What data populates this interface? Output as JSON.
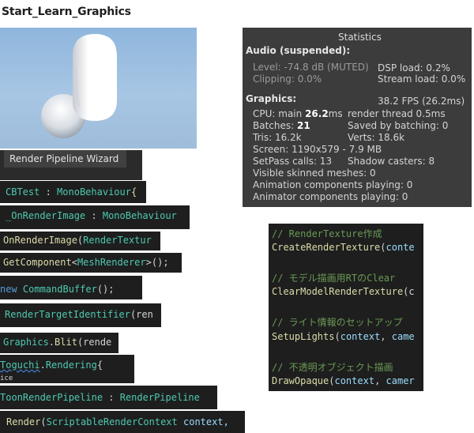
{
  "title": "Start_Learn_Graphics",
  "statistics": {
    "header": "Statistics",
    "audio_heading": "Audio (suspended):",
    "level": "Level: -74.8 dB (MUTED)",
    "clipping": "Clipping: 0.0%",
    "dsp_load": "DSP load: 0.2%",
    "stream_load": "Stream load: 0.0%",
    "graphics_heading": "Graphics:",
    "fps": "38.2 FPS (26.2ms)",
    "cpu_prefix": "CPU: main ",
    "cpu_value": "26.2",
    "cpu_suffix": "ms",
    "render_thread": "render thread 0.5ms",
    "batches_prefix": "Batches: ",
    "batches_value": "21",
    "saved_by_batching": "Saved by batching: 0",
    "tris": "Tris: 16.2k",
    "verts": "Verts: 18.6k",
    "screen": "Screen: 1190x579 - 7.9 MB",
    "setpass": "SetPass calls: 13",
    "shadow_casters": "Shadow casters: 8",
    "visible_skinned": "Visible skinned meshes: 0",
    "animation_components": "Animation components playing: 0",
    "animator_components": "Animator components playing: 0"
  },
  "wizard": {
    "label": "Render Pipeline Wizard"
  },
  "left_code": {
    "s1": {
      "a": "CBTest",
      "b": " : ",
      "c": "MonoBehaviour",
      "d": "{"
    },
    "s2": {
      "a": "_OnRenderImage",
      "b": " : ",
      "c": "MonoBehaviour"
    },
    "s3": {
      "a": "OnRenderImage",
      "b": "(",
      "c": "RenderTextur"
    },
    "s4": {
      "a": "GetComponent",
      "b": "<",
      "c": "MeshRenderer",
      "d": ">();"
    },
    "s5": {
      "a": "new ",
      "b": "CommandBuffer",
      "c": "();"
    },
    "s6": {
      "a": "RenderTargetIdentifier",
      "b": "(ren"
    },
    "s7": {
      "a": "Graphics",
      "b": ".",
      "c": "Blit",
      "d": "(rende"
    },
    "s8": {
      "a": "Toguchi",
      "b": ".",
      "c": "Rendering",
      "d": "{"
    },
    "s8_fragment": "ice",
    "s9": {
      "a": "ToonRenderPipeline",
      "b": " : ",
      "c": "RenderPipeline"
    },
    "s10": {
      "a": "Render",
      "b": "(",
      "c": "ScriptableRenderContext",
      "d": " context,"
    }
  },
  "right_code": {
    "c1": "// RenderTexture作成",
    "l1": {
      "a": "CreateRenderTexture",
      "b": "(",
      "c": "conte"
    },
    "c2": "// モデル描画用RTのClear",
    "l2": {
      "a": "ClearModelRenderTexture",
      "b": "(c"
    },
    "c3": "// ライト情報のセットアップ",
    "l3": {
      "a": "SetupLights",
      "b": "(",
      "c": "context",
      "d": ", ",
      "e": "came"
    },
    "c4": "// 不透明オブジェクト描画",
    "l4": {
      "a": "DrawOpaque",
      "b": "(",
      "c": "context",
      "d": ", ",
      "e": "camer"
    }
  }
}
